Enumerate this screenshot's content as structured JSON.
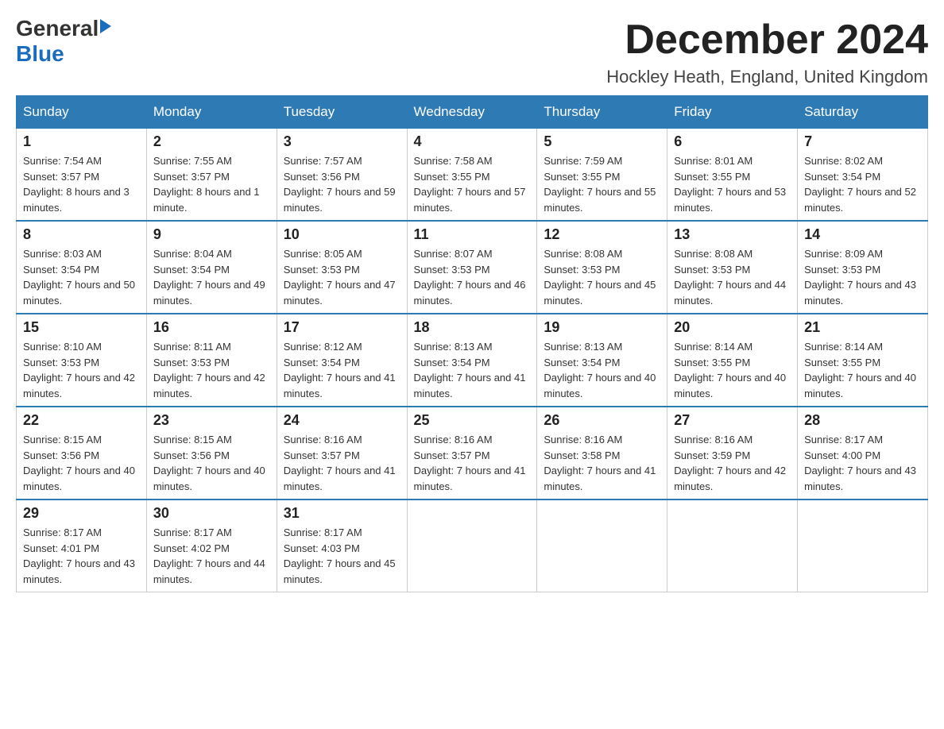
{
  "logo": {
    "general": "General",
    "blue": "Blue"
  },
  "title": "December 2024",
  "location": "Hockley Heath, England, United Kingdom",
  "days_of_week": [
    "Sunday",
    "Monday",
    "Tuesday",
    "Wednesday",
    "Thursday",
    "Friday",
    "Saturday"
  ],
  "weeks": [
    [
      {
        "day": "1",
        "sunrise": "7:54 AM",
        "sunset": "3:57 PM",
        "daylight": "8 hours and 3 minutes."
      },
      {
        "day": "2",
        "sunrise": "7:55 AM",
        "sunset": "3:57 PM",
        "daylight": "8 hours and 1 minute."
      },
      {
        "day": "3",
        "sunrise": "7:57 AM",
        "sunset": "3:56 PM",
        "daylight": "7 hours and 59 minutes."
      },
      {
        "day": "4",
        "sunrise": "7:58 AM",
        "sunset": "3:55 PM",
        "daylight": "7 hours and 57 minutes."
      },
      {
        "day": "5",
        "sunrise": "7:59 AM",
        "sunset": "3:55 PM",
        "daylight": "7 hours and 55 minutes."
      },
      {
        "day": "6",
        "sunrise": "8:01 AM",
        "sunset": "3:55 PM",
        "daylight": "7 hours and 53 minutes."
      },
      {
        "day": "7",
        "sunrise": "8:02 AM",
        "sunset": "3:54 PM",
        "daylight": "7 hours and 52 minutes."
      }
    ],
    [
      {
        "day": "8",
        "sunrise": "8:03 AM",
        "sunset": "3:54 PM",
        "daylight": "7 hours and 50 minutes."
      },
      {
        "day": "9",
        "sunrise": "8:04 AM",
        "sunset": "3:54 PM",
        "daylight": "7 hours and 49 minutes."
      },
      {
        "day": "10",
        "sunrise": "8:05 AM",
        "sunset": "3:53 PM",
        "daylight": "7 hours and 47 minutes."
      },
      {
        "day": "11",
        "sunrise": "8:07 AM",
        "sunset": "3:53 PM",
        "daylight": "7 hours and 46 minutes."
      },
      {
        "day": "12",
        "sunrise": "8:08 AM",
        "sunset": "3:53 PM",
        "daylight": "7 hours and 45 minutes."
      },
      {
        "day": "13",
        "sunrise": "8:08 AM",
        "sunset": "3:53 PM",
        "daylight": "7 hours and 44 minutes."
      },
      {
        "day": "14",
        "sunrise": "8:09 AM",
        "sunset": "3:53 PM",
        "daylight": "7 hours and 43 minutes."
      }
    ],
    [
      {
        "day": "15",
        "sunrise": "8:10 AM",
        "sunset": "3:53 PM",
        "daylight": "7 hours and 42 minutes."
      },
      {
        "day": "16",
        "sunrise": "8:11 AM",
        "sunset": "3:53 PM",
        "daylight": "7 hours and 42 minutes."
      },
      {
        "day": "17",
        "sunrise": "8:12 AM",
        "sunset": "3:54 PM",
        "daylight": "7 hours and 41 minutes."
      },
      {
        "day": "18",
        "sunrise": "8:13 AM",
        "sunset": "3:54 PM",
        "daylight": "7 hours and 41 minutes."
      },
      {
        "day": "19",
        "sunrise": "8:13 AM",
        "sunset": "3:54 PM",
        "daylight": "7 hours and 40 minutes."
      },
      {
        "day": "20",
        "sunrise": "8:14 AM",
        "sunset": "3:55 PM",
        "daylight": "7 hours and 40 minutes."
      },
      {
        "day": "21",
        "sunrise": "8:14 AM",
        "sunset": "3:55 PM",
        "daylight": "7 hours and 40 minutes."
      }
    ],
    [
      {
        "day": "22",
        "sunrise": "8:15 AM",
        "sunset": "3:56 PM",
        "daylight": "7 hours and 40 minutes."
      },
      {
        "day": "23",
        "sunrise": "8:15 AM",
        "sunset": "3:56 PM",
        "daylight": "7 hours and 40 minutes."
      },
      {
        "day": "24",
        "sunrise": "8:16 AM",
        "sunset": "3:57 PM",
        "daylight": "7 hours and 41 minutes."
      },
      {
        "day": "25",
        "sunrise": "8:16 AM",
        "sunset": "3:57 PM",
        "daylight": "7 hours and 41 minutes."
      },
      {
        "day": "26",
        "sunrise": "8:16 AM",
        "sunset": "3:58 PM",
        "daylight": "7 hours and 41 minutes."
      },
      {
        "day": "27",
        "sunrise": "8:16 AM",
        "sunset": "3:59 PM",
        "daylight": "7 hours and 42 minutes."
      },
      {
        "day": "28",
        "sunrise": "8:17 AM",
        "sunset": "4:00 PM",
        "daylight": "7 hours and 43 minutes."
      }
    ],
    [
      {
        "day": "29",
        "sunrise": "8:17 AM",
        "sunset": "4:01 PM",
        "daylight": "7 hours and 43 minutes."
      },
      {
        "day": "30",
        "sunrise": "8:17 AM",
        "sunset": "4:02 PM",
        "daylight": "7 hours and 44 minutes."
      },
      {
        "day": "31",
        "sunrise": "8:17 AM",
        "sunset": "4:03 PM",
        "daylight": "7 hours and 45 minutes."
      },
      null,
      null,
      null,
      null
    ]
  ]
}
